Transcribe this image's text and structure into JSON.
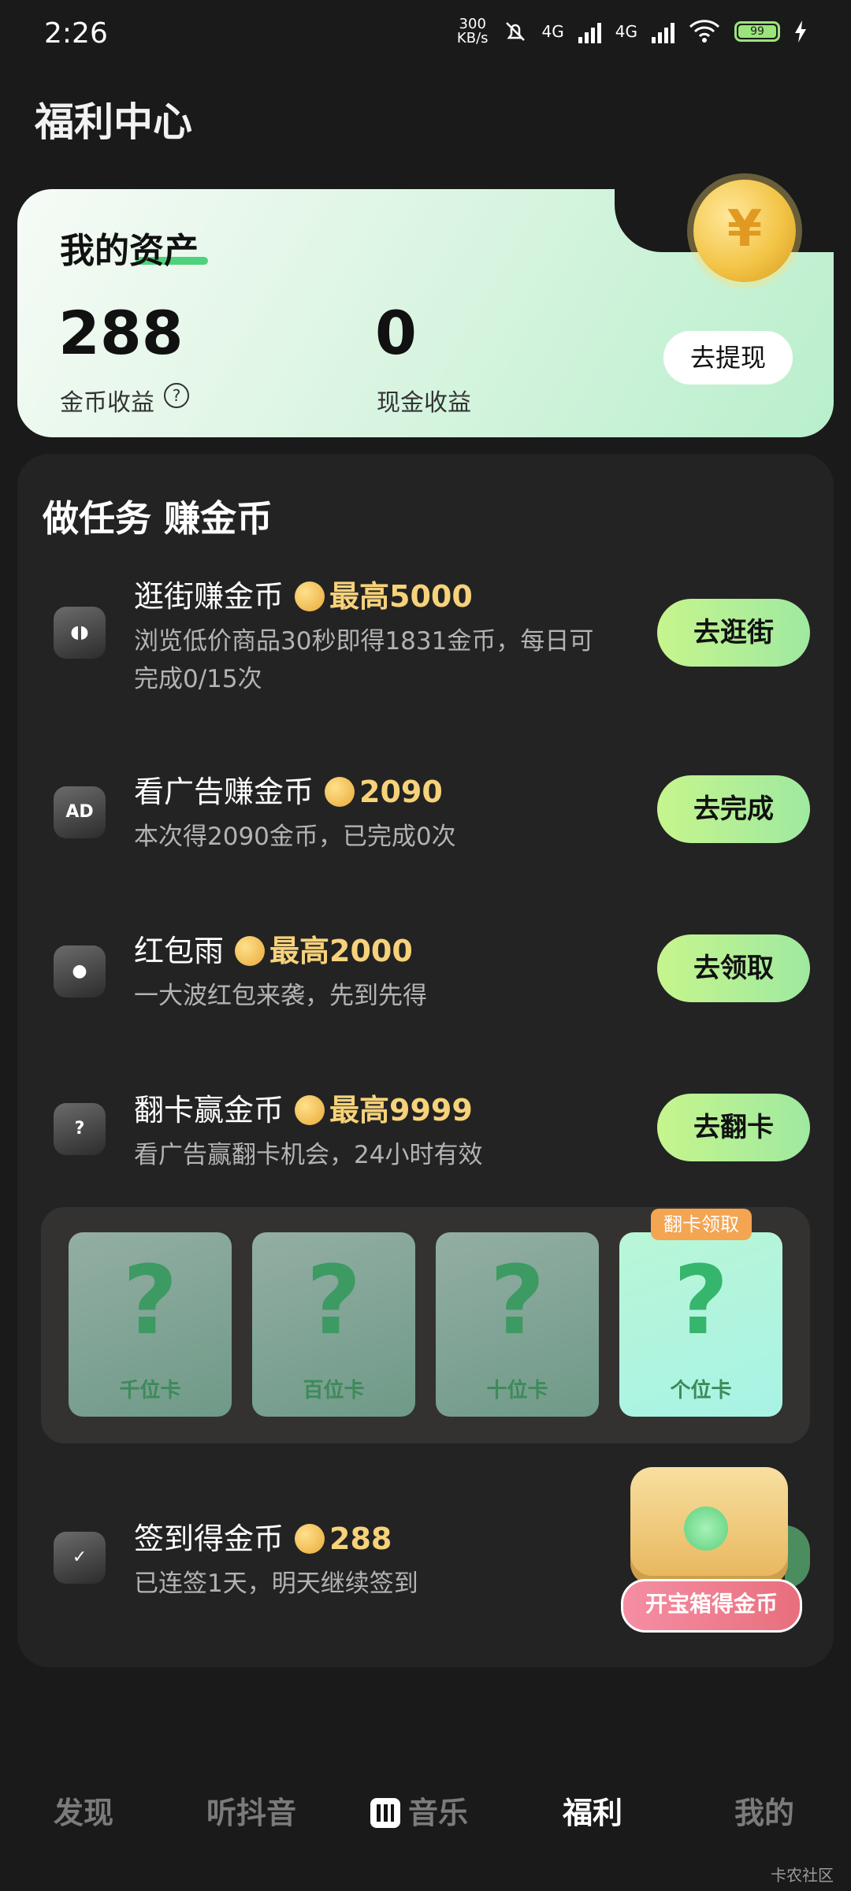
{
  "status_bar": {
    "time": "2:26",
    "speed": "300",
    "speed_unit": "KB/s",
    "net1": "4G",
    "net2": "4G",
    "battery": "99"
  },
  "page_title": "福利中心",
  "assets": {
    "title": "我的资产",
    "coin_value": "288",
    "coin_label": "金币收益",
    "cash_value": "0",
    "cash_label": "现金收益",
    "withdraw": "去提现"
  },
  "tasks_heading": "做任务 赚金币",
  "tasks": [
    {
      "title": "逛街赚金币",
      "reward": "最高5000",
      "desc_line1": "浏览低价商品30秒即得1831金币，每日可",
      "desc_line2": "完成0/15次",
      "button": "去逛街",
      "icon": "bag-icon"
    },
    {
      "title": "看广告赚金币",
      "reward": "2090",
      "desc_line1": "本次得2090金币，已完成0次",
      "button": "去完成",
      "icon_text": "AD",
      "icon": "ad-icon"
    },
    {
      "title": "红包雨",
      "reward": "最高2000",
      "desc_line1": "一大波红包来袭，先到先得",
      "button": "去领取",
      "icon": "red-packet-icon"
    },
    {
      "title": "翻卡赢金币",
      "reward": "最高9999",
      "desc_line1": "看广告赢翻卡机会，24小时有效",
      "button": "去翻卡",
      "icon_text": "?",
      "icon": "card-icon"
    }
  ],
  "flip_cards": {
    "symbol": "?",
    "badge": "翻卡领取",
    "labels": [
      "千位卡",
      "百位卡",
      "十位卡",
      "个位卡"
    ]
  },
  "checkin": {
    "title": "签到得金币",
    "reward": "288",
    "desc": "已连签1天，明天继续签到",
    "chest_button": "开宝箱得金币"
  },
  "nav": [
    "发现",
    "听抖音",
    "音乐",
    "福利",
    "我的"
  ],
  "watermark": "卡农社区"
}
